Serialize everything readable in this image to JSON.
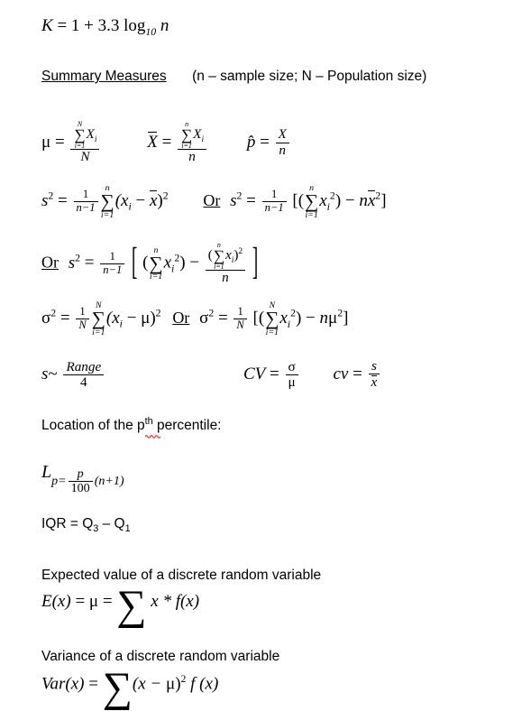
{
  "document": {
    "title": "Statistics Summary Measures Formula Sheet",
    "background_color": "#ffffff",
    "text_color": "#000000",
    "spellcheck_underline_color": "#e8202a"
  },
  "lines": {
    "sturges": {
      "k": "K",
      "eq": " = 1 + 3.3 log",
      "base": "10",
      "n": " n"
    },
    "heading": {
      "title": "Summary Measures",
      "note": "(n – sample size; N – Population size)"
    },
    "mean_row": {
      "mu_symbol": "μ",
      "equals": " = ",
      "mu_num_sum": "∑",
      "mu_lower": "i=1",
      "mu_upper": "N",
      "mu_num_var": "X",
      "mu_num_sub": "i",
      "mu_den": "N",
      "xbar_symbol": "X",
      "xbar_num_sum": "∑",
      "xbar_lower": "i=1",
      "xbar_upper": "n",
      "xbar_num_var": "X",
      "xbar_num_sub": "i",
      "xbar_den": "n",
      "phat_symbol": "p̂",
      "phat_num": "X",
      "phat_den": "n"
    },
    "sample_variance": {
      "s": "s",
      "s_exp": "2",
      "equals": " = ",
      "one": "1",
      "n_minus_1": "n−1",
      "sum": "∑",
      "lower": "i=1",
      "upper": "n",
      "body": "(x",
      "body_sub": "i",
      "minus": " − ",
      "xbar": "x",
      "close": ")",
      "close_exp": "2",
      "or": "Or",
      "alt_open": "[(",
      "alt_sum": "∑",
      "alt_lower": "i=1",
      "alt_upper": "n",
      "alt_var": "x",
      "alt_var_sub": "i",
      "alt_var_exp": "2",
      "alt_mid": ") − ",
      "alt_n": "n",
      "alt_xbar": "x",
      "alt_xbar_exp": "2",
      "alt_close": "]"
    },
    "sample_variance_alt2": {
      "or": "Or",
      "s": "s",
      "s_exp": "2",
      "equals": " = ",
      "one": "1",
      "n_minus_1": "n−1",
      "open_bracket": "[",
      "open_paren": "(",
      "sum": "∑",
      "lower": "i=1",
      "upper": "n",
      "var": "x",
      "var_sub": "i",
      "var_exp": "2",
      "close_paren": ")",
      "minus": " − ",
      "frac_num_open": "(",
      "frac_num_sum": "∑",
      "frac_num_lower": "i=1",
      "frac_num_upper": "n",
      "frac_num_var": "x",
      "frac_num_sub": "i",
      "frac_num_close": ")",
      "frac_num_exp": "2",
      "frac_den": "n",
      "close_bracket": "]"
    },
    "population_variance": {
      "sigma": "σ",
      "sigma_exp": "2",
      "equals": " = ",
      "one": "1",
      "N": "N",
      "sum": "∑",
      "lower": "i=1",
      "upper": "N",
      "body": "(x",
      "body_sub": "i",
      "minus": " − ",
      "mu": "μ",
      "close": ")",
      "close_exp": "2",
      "or": "Or",
      "alt_sigma": "σ",
      "alt_sigma_exp": "2",
      "alt_one": "1",
      "alt_N": "N",
      "alt_open": "[(",
      "alt_sum": "∑",
      "alt_lower": "i=1",
      "alt_upper": "N",
      "alt_var": "x",
      "alt_var_sub": "i",
      "alt_var_exp": "2",
      "alt_mid": ") − ",
      "alt_n": "n",
      "alt_mu": "μ",
      "alt_mu_exp": "2",
      "alt_close": "]"
    },
    "range_rule": {
      "s": "s",
      "tilde": "~",
      "num": "Range",
      "den": "4",
      "cv_upper": "CV",
      "cv_equals": " = ",
      "cv_num": "σ",
      "cv_den": "μ",
      "cv_lower": "cv",
      "cv_lower_equals": " = ",
      "cv_lower_num": "s",
      "cv_lower_den": "x"
    },
    "percentile_label": {
      "pre": "Location of the p",
      "th": "th",
      "post": " percentile:"
    },
    "percentile_formula": {
      "L": "L",
      "sub_p_eq": "p=",
      "num": "p",
      "den": "100",
      "tail": "(n+1)"
    },
    "iqr": {
      "text": "IQR = Q",
      "sub3": "3",
      "minus": " – Q",
      "sub1": "1"
    },
    "expected_value": {
      "label": "Expected value of a discrete random variable",
      "E": "E",
      "x1": "(x)",
      "equals1": " = ",
      "mu": "μ",
      "equals2": " = ",
      "sum": "∑",
      "body": " x * f(x)"
    },
    "variance_discrete": {
      "label": "Variance of a discrete random variable",
      "Var": "Var",
      "x1": "(x)",
      "equals": " = ",
      "sum": "∑",
      "open": "(x − ",
      "mu": "μ",
      "close": ")",
      "exp": "2",
      "tail": " f (x)"
    }
  }
}
